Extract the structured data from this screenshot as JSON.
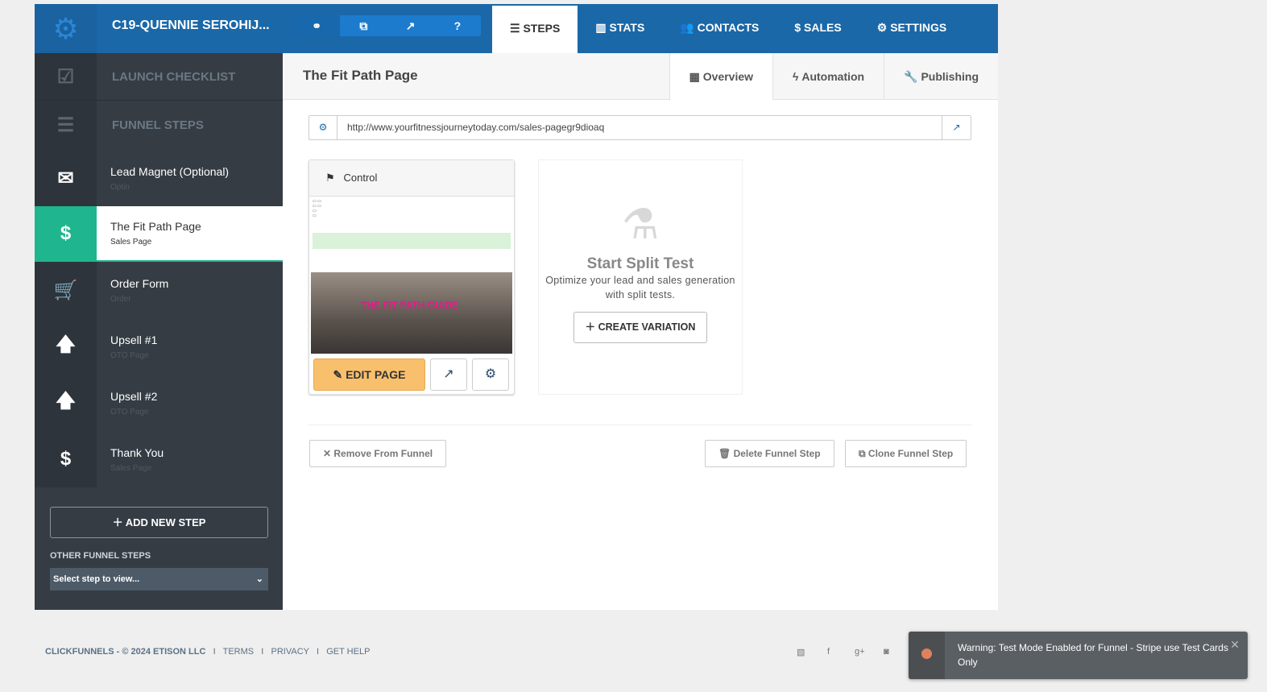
{
  "header": {
    "funnel_title": "C19-QUENNIE SEROHIJ...",
    "tools": [
      "link-icon",
      "copy-icon",
      "external-link-icon",
      "help-icon"
    ],
    "nav": [
      {
        "label": "STEPS",
        "icon": "☰"
      },
      {
        "label": "STATS",
        "icon": "▥"
      },
      {
        "label": "CONTACTS",
        "icon": "👥"
      },
      {
        "label": "SALES",
        "icon": "$"
      },
      {
        "label": "SETTINGS",
        "icon": "⚙"
      }
    ]
  },
  "sidebar": {
    "launch": "LAUNCH CHECKLIST",
    "funnel_steps": "FUNNEL STEPS",
    "steps": [
      {
        "name": "Lead Magnet (Optional)",
        "type": "Optin",
        "icon": "✉"
      },
      {
        "name": "The Fit Path Page",
        "type": "Sales Page",
        "icon": "$"
      },
      {
        "name": "Order Form",
        "type": "Order",
        "icon": "🛒"
      },
      {
        "name": "Upsell #1",
        "type": "OTO Page",
        "icon": "🡅"
      },
      {
        "name": "Upsell #2",
        "type": "OTO Page",
        "icon": "🡅"
      },
      {
        "name": "Thank You",
        "type": "Sales Page",
        "icon": "$"
      }
    ],
    "add_step": "ADD NEW STEP",
    "other_label": "OTHER FUNNEL STEPS",
    "select_value": "Select step to view..."
  },
  "page": {
    "title": "The Fit Path Page",
    "tabs": [
      "Overview",
      "Automation",
      "Publishing"
    ],
    "url": "http://www.yourfitnessjourneytoday.com/sales-pagegr9dioaq",
    "variant": {
      "label": "Control",
      "thumb_headline": "THE FIT PATH GUIDE",
      "edit": "EDIT PAGE"
    },
    "split": {
      "title": "Start Split Test",
      "desc": "Optimize your lead and sales generation with split tests.",
      "button": "CREATE VARIATION"
    },
    "actions": {
      "remove": "Remove From Funnel",
      "delete": "Delete Funnel Step",
      "clone": "Clone Funnel Step"
    }
  },
  "footer": {
    "copyright": "CLICKFUNNELS - © 2024 ETISON LLC",
    "links": [
      "TERMS",
      "PRIVACY",
      "GET HELP"
    ]
  },
  "toast": {
    "message": "Warning: Test Mode Enabled for Funnel - Stripe use Test Cards Only"
  }
}
